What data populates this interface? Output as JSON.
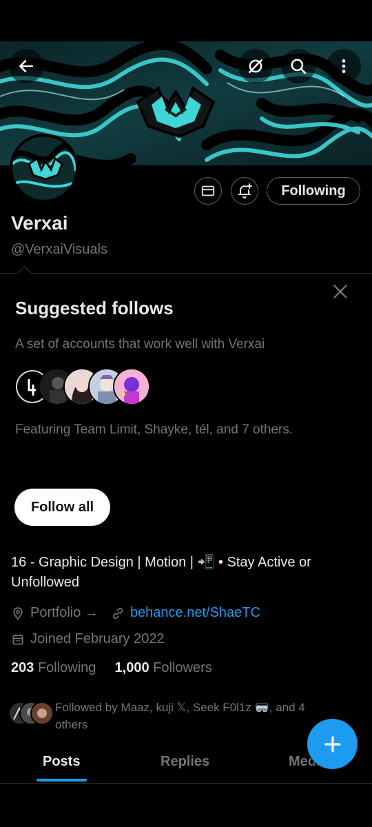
{
  "profile": {
    "name": "Verxai",
    "handle": "@VerxaiVisuals",
    "bio": "16 - Graphic Design | Motion |  📲 • Stay Active or Unfollowed",
    "website_label": "Portfolio →",
    "website_link": "behance.net/ShaeTC",
    "joined": "Joined February 2022",
    "following_count": "203",
    "following_label": "Following",
    "followers_count": "1,000",
    "followers_label": "Followers",
    "followed_by": "Followed by Maaz, kuji 𝕏, Seek F0l1z 🥽, and 4 others"
  },
  "actions": {
    "following_button": "Following"
  },
  "suggested": {
    "title": "Suggested follows",
    "subtitle": "A set of accounts that work well with Verxai",
    "featuring": "Featuring Team Limit, Shayke, tél, and 7 others.",
    "follow_all": "Follow all"
  },
  "tabs": [
    "Posts",
    "Replies",
    "Media"
  ],
  "colors": {
    "accent": "#1d9bf0",
    "background": "#000000",
    "primary_text": "#e7e9ea",
    "secondary_text": "#71767b",
    "border": "#2f3336",
    "banner_cyan": "#3fd6d8"
  },
  "icons": {
    "back": "back-arrow-icon",
    "grok": "grok-icon",
    "search": "search-icon",
    "more": "more-vertical-icon",
    "message": "envelope-icon",
    "notify": "bell-plus-icon",
    "close": "close-icon",
    "location": "location-pin-icon",
    "link": "link-icon",
    "calendar": "calendar-icon",
    "compose": "plus-icon"
  }
}
